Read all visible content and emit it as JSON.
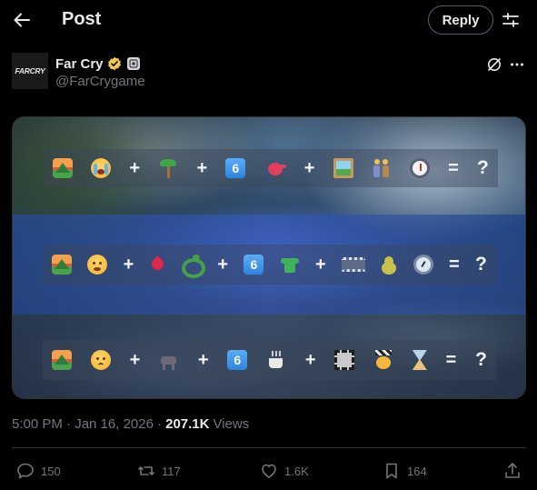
{
  "header": {
    "title": "Post",
    "reply_label": "Reply"
  },
  "author": {
    "avatar_text": "FARCRY",
    "name": "Far Cry",
    "handle": "@FarCrygame"
  },
  "puzzle": {
    "rows": [
      {
        "tokens": [
          "mountain-sunrise",
          "crying-face",
          "+",
          "palm-tree",
          "+",
          "keycap-6",
          "teapot",
          "+",
          "framed-picture",
          "people",
          "stopwatch",
          "=",
          "?"
        ]
      },
      {
        "tokens": [
          "mountain-sunrise",
          "anguished-face",
          "+",
          "drop-of-blood",
          "snake",
          "+",
          "keycap-6",
          "t-shirt",
          "+",
          "film-frames",
          "pear",
          "gauge",
          "=",
          "?"
        ]
      },
      {
        "tokens": [
          "mountain-sunrise",
          "frowning-face",
          "+",
          "donkey",
          "+",
          "keycap-6",
          "hot-beverage",
          "+",
          "frame",
          "clapper-face",
          "hourglass",
          "=",
          "?"
        ]
      }
    ],
    "plus": "+",
    "equals": "=",
    "question": "?",
    "six": "6"
  },
  "meta": {
    "timestamp": "5:00 PM · Jan 16, 2026 ·",
    "views_count": "207.1K",
    "views_label": "Views"
  },
  "actions": {
    "replies": "150",
    "reposts": "117",
    "likes": "1.6K",
    "bookmarks": "164"
  },
  "colors": {
    "background": "#000000",
    "text_primary": "#e7e9ea",
    "text_secondary": "#71767b",
    "border": "#2f3336",
    "verified": "#f2c94c"
  }
}
